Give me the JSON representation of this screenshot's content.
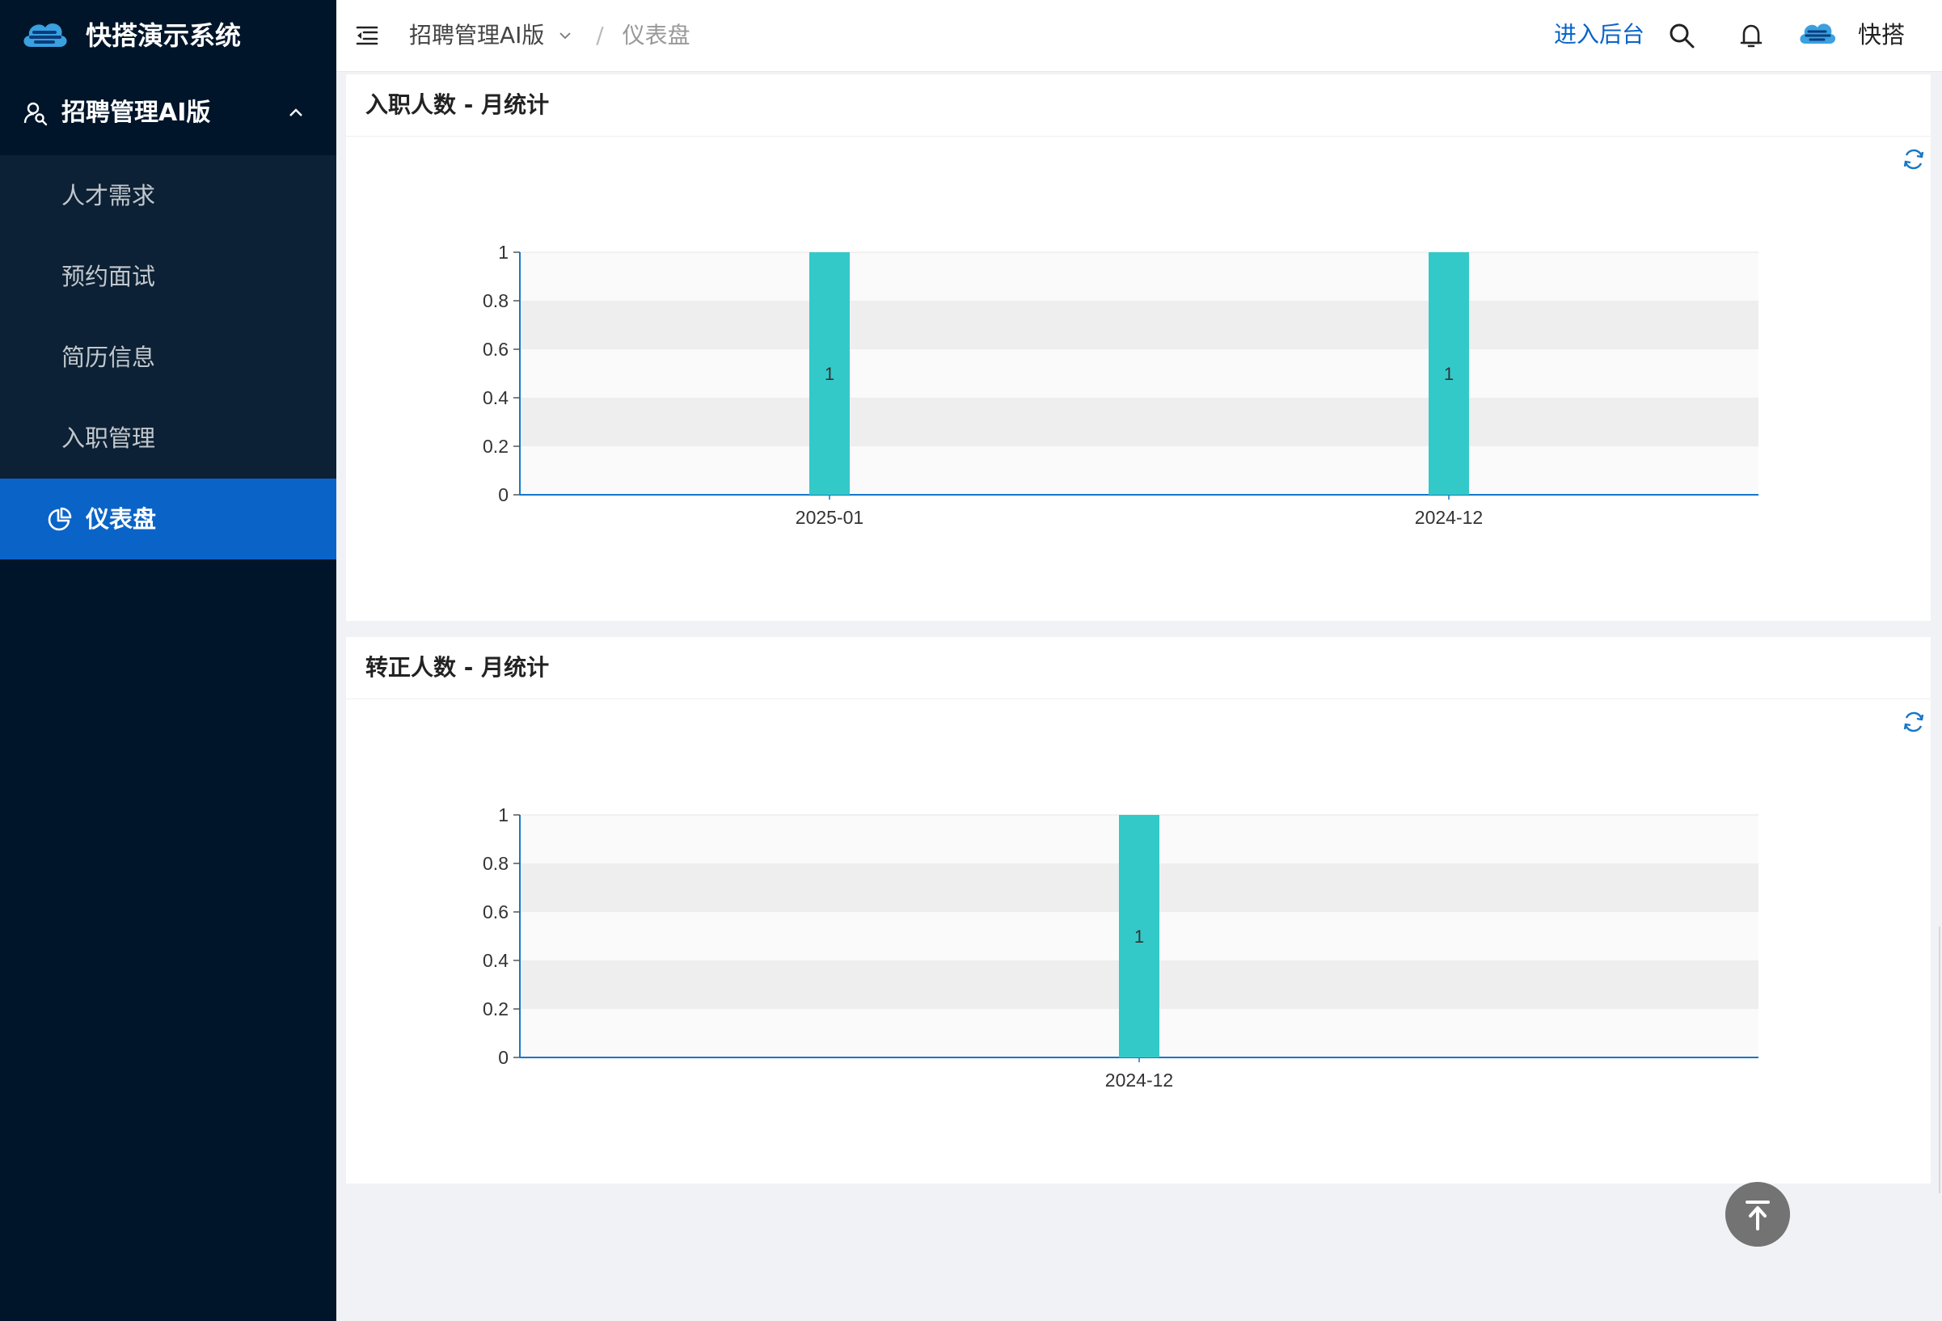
{
  "brand": {
    "title": "快搭演示系统",
    "logo_icon": "cloud-logo-icon"
  },
  "sidebar": {
    "group": {
      "label": "招聘管理AI版",
      "icon": "user-search-icon",
      "expanded": true
    },
    "items": [
      {
        "label": "人才需求",
        "active": false
      },
      {
        "label": "预约面试",
        "active": false
      },
      {
        "label": "简历信息",
        "active": false
      },
      {
        "label": "入职管理",
        "active": false
      },
      {
        "label": "仪表盘",
        "active": true,
        "icon": "pie-chart-icon"
      }
    ],
    "colors": {
      "background": "#001529",
      "submenu": "#0c2135",
      "active": "#0a64c8"
    }
  },
  "header": {
    "breadcrumb": {
      "root": "招聘管理AI版",
      "separator": "/",
      "current": "仪表盘"
    },
    "enter_admin": "进入后台",
    "user_name": "快搭",
    "link_color": "#0a64c8"
  },
  "cards": [
    {
      "title": "入职人数 - 月统计"
    },
    {
      "title": "转正人数 - 月统计"
    }
  ],
  "chart_data": [
    {
      "type": "bar",
      "title": "入职人数 - 月统计",
      "categories": [
        "2025-01",
        "2024-12"
      ],
      "values": [
        1,
        1
      ],
      "data_labels": [
        "1",
        "1"
      ],
      "ylim": [
        0,
        1
      ],
      "yticks": [
        "0",
        "0.2",
        "0.4",
        "0.6",
        "0.8",
        "1"
      ],
      "xlabel": "",
      "ylabel": "",
      "bar_color": "#33c9c9",
      "grid": "horizontal bands"
    },
    {
      "type": "bar",
      "title": "转正人数 - 月统计",
      "categories": [
        "2024-12"
      ],
      "values": [
        1
      ],
      "data_labels": [
        "1"
      ],
      "ylim": [
        0,
        1
      ],
      "yticks": [
        "0",
        "0.2",
        "0.4",
        "0.6",
        "0.8",
        "1"
      ],
      "xlabel": "",
      "ylabel": "",
      "bar_color": "#33c9c9",
      "grid": "horizontal bands"
    }
  ]
}
